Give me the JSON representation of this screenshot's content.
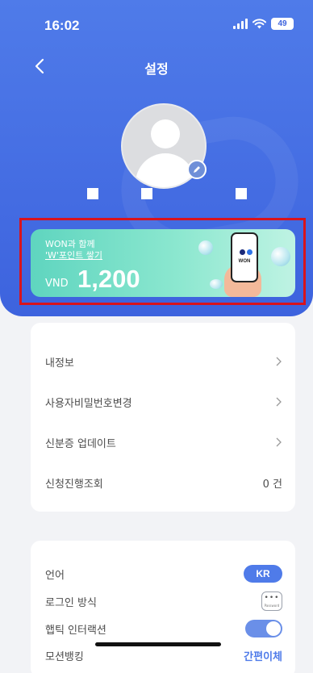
{
  "status_bar": {
    "time": "16:02",
    "battery": "49"
  },
  "header": {
    "title": "설정"
  },
  "promo": {
    "line1": "WON과 함께",
    "line2": "'W'포인트 쌓기",
    "currency": "VND",
    "amount": "1,200",
    "phone_brand": "WON"
  },
  "menu": [
    {
      "label": "내정보"
    },
    {
      "label": "사용자비밀번호변경"
    },
    {
      "label": "신분증 업데이트"
    },
    {
      "label": "신청진행조회",
      "value": "0 건"
    }
  ],
  "preferences": {
    "language_label": "언어",
    "language_value": "KR",
    "login_method_label": "로그인 방식",
    "login_method_icon_text": "Password",
    "haptic_label": "햅틱 인터랙션",
    "haptic_on": true,
    "motion_banking_label": "모션뱅킹",
    "motion_banking_value": "간편이체"
  },
  "colors": {
    "primary": "#4f7be9",
    "promo_green": "#5fd5bf",
    "highlight_red": "#d9131b",
    "background": "#f2f3f6"
  },
  "icons": [
    "back-icon",
    "signal-icon",
    "wifi-icon",
    "battery-icon",
    "avatar-icon",
    "edit-icon",
    "chevron-right-icon",
    "password-icon",
    "toggle-switch"
  ]
}
